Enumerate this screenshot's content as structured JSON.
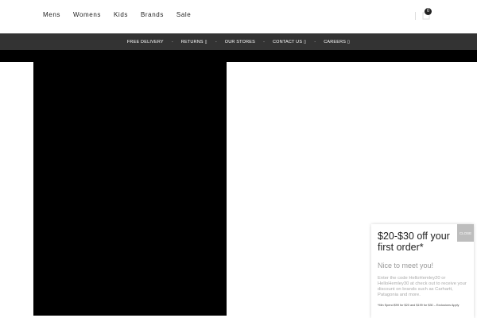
{
  "header": {
    "nav": [
      "Mens",
      "Womens",
      "Kids",
      "Brands",
      "Sale"
    ],
    "cart_count": "0"
  },
  "utility_bar": {
    "items": [
      "FREE DELIVERY",
      "RETURNS ▯",
      "OUR STORES",
      "CONTACT US ▯",
      "CAREERS ▯"
    ],
    "separator": "-"
  },
  "popup": {
    "title": "$20-$30 off your first order*",
    "subtitle": "Nice to meet you!",
    "body": "Enter the code HelloHemley20 or HelloHemley30 at check out to receive your discount on brands such as Carhartt, Patagonia and more.",
    "fine_print": "*Min Spend $99 for $20 and $199 for $30 – Exclusions Apply",
    "close_label": "CLOSE"
  },
  "icons": {
    "cart": "shopping-bag-icon"
  }
}
